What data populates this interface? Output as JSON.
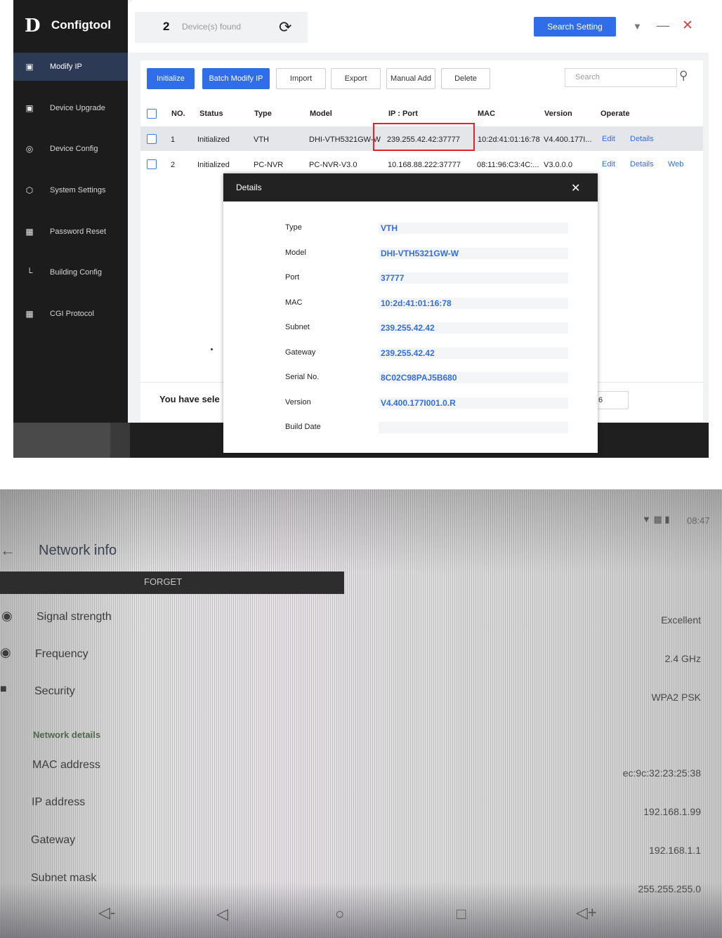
{
  "app": {
    "name": "Configtool",
    "logo_glyph": "D"
  },
  "sidebar": {
    "items": [
      {
        "label": "Modify IP",
        "icon": "ip-icon",
        "active": true
      },
      {
        "label": "Device Upgrade",
        "icon": "upgrade-icon"
      },
      {
        "label": "Device Config",
        "icon": "config-icon"
      },
      {
        "label": "System Settings",
        "icon": "settings-icon"
      },
      {
        "label": "Password Reset",
        "icon": "lock-icon"
      },
      {
        "label": "Building Config",
        "icon": "building-icon"
      },
      {
        "label": "CGI Protocol",
        "icon": "grid-icon"
      }
    ]
  },
  "topbar": {
    "device_count": "2",
    "found_label": "Device(s) found",
    "search_setting": "Search Setting"
  },
  "toolbar": {
    "initialize": "Initialize",
    "batch_modify_ip": "Batch Modify IP",
    "import": "Import",
    "export": "Export",
    "manual_add": "Manual Add",
    "delete": "Delete",
    "search_placeholder": "Search"
  },
  "table": {
    "headers": [
      "NO.",
      "Status",
      "Type",
      "Model",
      "IP : Port",
      "MAC",
      "Version",
      "Operate"
    ],
    "rows": [
      {
        "no": "1",
        "status": "Initialized",
        "type": "VTH",
        "model": "DHI-VTH5321GW-W",
        "ip_port": "239.255.42.42:37777",
        "mac": "10:2d:41:01:16:78",
        "version": "V4.400.177I...",
        "edit": "Edit",
        "details": "Details"
      },
      {
        "no": "2",
        "status": "Initialized",
        "type": "PC-NVR",
        "model": "PC-NVR-V3.0",
        "ip_port": "10.168.88.222:37777",
        "mac": "08:11:96:C3:4C:...",
        "version": "V3.0.0.0",
        "edit": "Edit",
        "details": "Details",
        "web": "Web"
      }
    ]
  },
  "footer": {
    "selected_text": "You have sele",
    "page_value": "6"
  },
  "dialog": {
    "title": "Details",
    "fields": [
      {
        "label": "Type",
        "value": "VTH"
      },
      {
        "label": "Model",
        "value": "DHI-VTH5321GW-W"
      },
      {
        "label": "Port",
        "value": "37777"
      },
      {
        "label": "MAC",
        "value": "10:2d:41:01:16:78"
      },
      {
        "label": "Subnet",
        "value": "239.255.42.42"
      },
      {
        "label": "Gateway",
        "value": "239.255.42.42"
      },
      {
        "label": "Serial No.",
        "value": "8C02C98PAJ5B680"
      },
      {
        "label": "Version",
        "value": "V4.400.177I001.0.R"
      },
      {
        "label": "Build Date",
        "value": ""
      }
    ]
  },
  "phone": {
    "time": "08:47",
    "title": "Network info",
    "forget": "FORGET",
    "rows": [
      {
        "label": "Signal strength",
        "value": "Excellent"
      },
      {
        "label": "Frequency",
        "value": "2.4 GHz"
      },
      {
        "label": "Security",
        "value": "WPA2 PSK"
      }
    ],
    "section": "Network details",
    "details": [
      {
        "label": "MAC address",
        "value": "ec:9c:32:23:25:38"
      },
      {
        "label": "IP address",
        "value": "192.168.1.99"
      },
      {
        "label": "Gateway",
        "value": "192.168.1.1"
      },
      {
        "label": "Subnet mask",
        "value": "255.255.255.0"
      }
    ]
  },
  "colors": {
    "accent": "#2f6ee8",
    "sidebar_bg": "#1c1c1c",
    "highlight": "#e0242a"
  }
}
